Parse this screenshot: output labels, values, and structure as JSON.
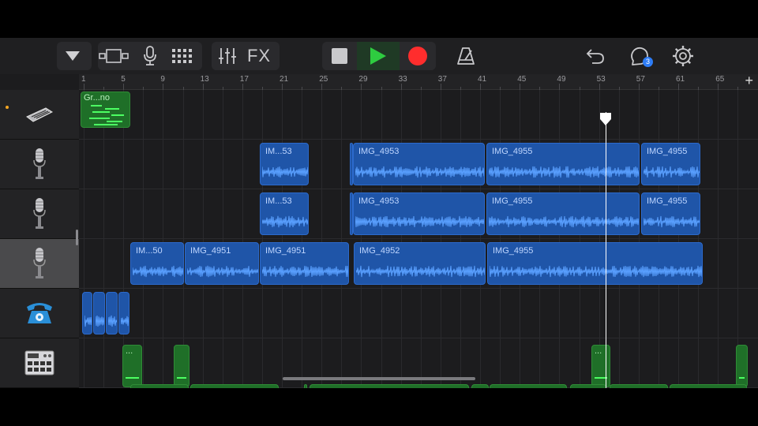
{
  "toolbar": {
    "fx_label": "FX",
    "loops_badge": "3",
    "colors": {
      "record": "#ff2d2d",
      "play": "#2ecc40"
    }
  },
  "ruler": {
    "marks": [
      "1",
      "5",
      "9",
      "13",
      "17",
      "21",
      "25",
      "29",
      "33",
      "37",
      "41",
      "45",
      "49",
      "53",
      "57",
      "61",
      "65"
    ],
    "add_label": "+"
  },
  "tracks": [
    {
      "icon": "keyboard-instrument-icon",
      "regions": [
        {
          "label": "Gr...no",
          "color": "green"
        }
      ]
    },
    {
      "icon": "microphone-icon",
      "regions": [
        {
          "label": "IM...53",
          "color": "blue"
        },
        {
          "label": "",
          "color": "blue"
        },
        {
          "label": "IMG_4953",
          "color": "blue"
        },
        {
          "label": "IMG_4955",
          "color": "blue"
        },
        {
          "label": "IMG_4955",
          "color": "blue"
        }
      ]
    },
    {
      "icon": "microphone-icon",
      "regions": [
        {
          "label": "IM...53",
          "color": "blue"
        },
        {
          "label": "",
          "color": "blue"
        },
        {
          "label": "IMG_4953",
          "color": "blue"
        },
        {
          "label": "IMG_4955",
          "color": "blue"
        },
        {
          "label": "IMG_4955",
          "color": "blue"
        }
      ]
    },
    {
      "icon": "microphone-icon",
      "selected": true,
      "regions": [
        {
          "label": "IM...50",
          "color": "blue"
        },
        {
          "label": "IMG_4951",
          "color": "blue"
        },
        {
          "label": "IMG_4951",
          "color": "blue"
        },
        {
          "label": "IMG_4952",
          "color": "blue"
        },
        {
          "label": "IMG_4955",
          "color": "blue"
        }
      ]
    },
    {
      "icon": "telephone-icon",
      "regions": [
        {
          "label": "",
          "color": "blue"
        },
        {
          "label": "",
          "color": "blue"
        },
        {
          "label": "",
          "color": "blue"
        },
        {
          "label": "",
          "color": "blue"
        }
      ]
    },
    {
      "icon": "drum-machine-icon",
      "regions": [
        {
          "label": "...",
          "color": "green"
        },
        {
          "label": "",
          "color": "green"
        },
        {
          "label": "...",
          "color": "green"
        },
        {
          "label": "",
          "color": "green"
        }
      ]
    }
  ]
}
